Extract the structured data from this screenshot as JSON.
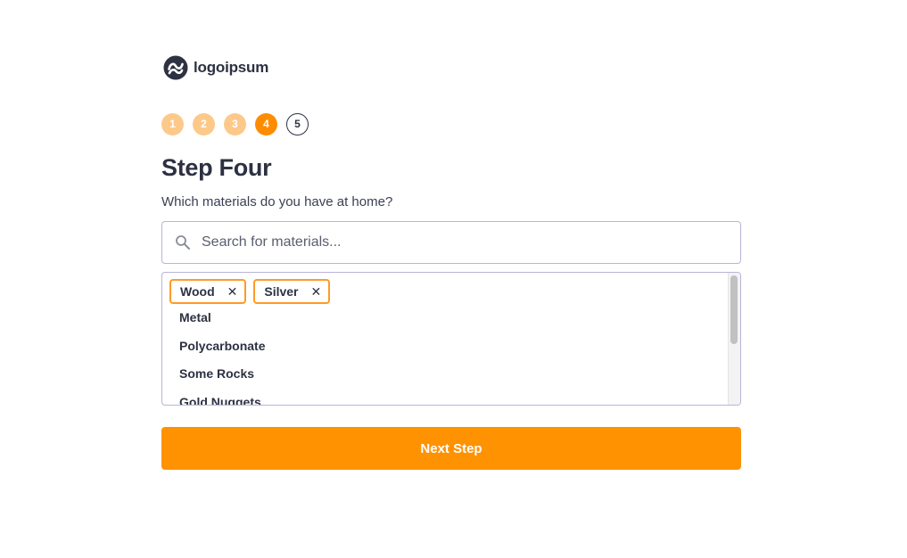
{
  "brand": {
    "name": "logoipsum",
    "icon": "logoipsum-logo-icon",
    "color": "#2d3142"
  },
  "steps": [
    {
      "label": "1",
      "state": "done"
    },
    {
      "label": "2",
      "state": "done"
    },
    {
      "label": "3",
      "state": "done"
    },
    {
      "label": "4",
      "state": "current"
    },
    {
      "label": "5",
      "state": "todo"
    }
  ],
  "page": {
    "title": "Step Four",
    "question": "Which materials do you have at home?"
  },
  "search": {
    "placeholder": "Search for materials...",
    "value": "",
    "icon": "search-icon"
  },
  "selected": [
    {
      "label": "Wood",
      "remove_icon": "close-icon"
    },
    {
      "label": "Silver",
      "remove_icon": "close-icon"
    }
  ],
  "options": [
    "Metal",
    "Polycarbonate",
    "Some Rocks",
    "Gold Nuggets"
  ],
  "actions": {
    "next_label": "Next Step"
  },
  "colors": {
    "accent": "#ff9200",
    "step_done": "#fdc98a",
    "step_current": "#ff8c00",
    "chip_border": "#ff9a26",
    "input_border": "#b8b4d8"
  }
}
